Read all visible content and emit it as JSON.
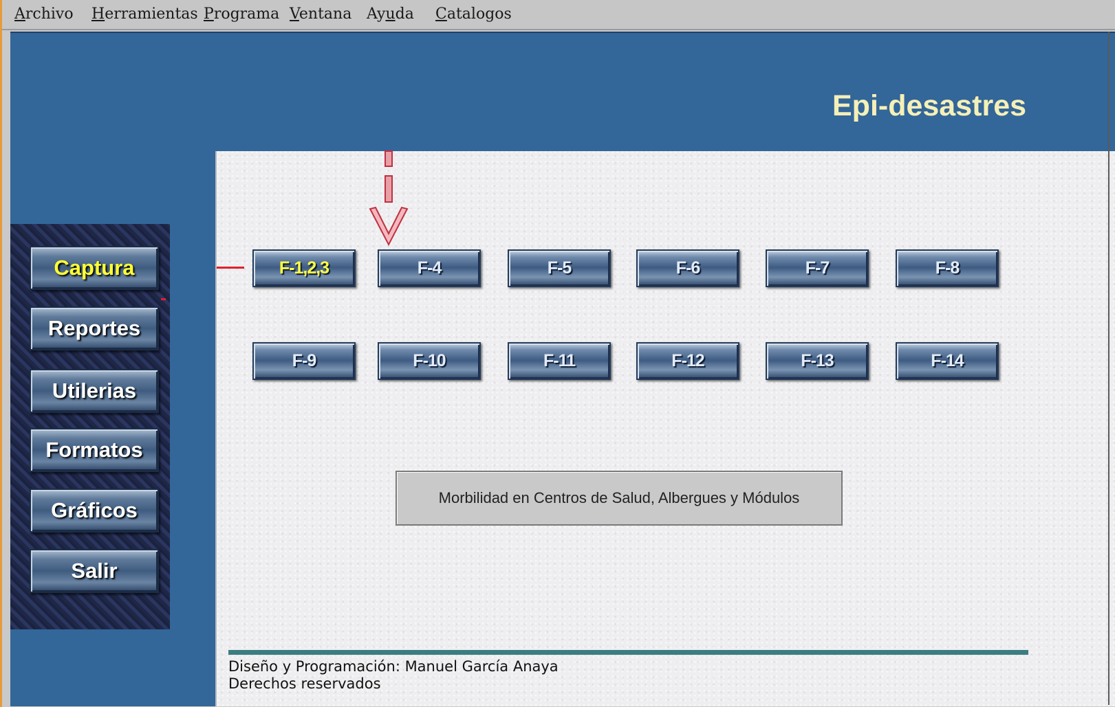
{
  "menubar": {
    "items": [
      {
        "accel": "A",
        "rest": "rchivo"
      },
      {
        "accel": "H",
        "rest": "erramientas"
      },
      {
        "accel": "P",
        "rest": "rograma"
      },
      {
        "accel": "V",
        "rest": "entana"
      },
      {
        "pre": "Ay",
        "accel": "u",
        "rest": "da"
      },
      {
        "accel": "C",
        "rest": "atalogos"
      }
    ]
  },
  "app": {
    "title": "Epi-desastres"
  },
  "sidebar": {
    "items": [
      {
        "label": "Captura",
        "active": true
      },
      {
        "label": "Reportes",
        "active": false
      },
      {
        "label": "Utilerias",
        "active": false
      },
      {
        "label": "Formatos",
        "active": false
      },
      {
        "label": "Gráficos",
        "active": false
      },
      {
        "label": "Salir",
        "active": false
      }
    ]
  },
  "forms": {
    "row1": [
      {
        "label": "F-1,2,3",
        "active": true
      },
      {
        "label": "F-4",
        "active": false
      },
      {
        "label": "F-5",
        "active": false
      },
      {
        "label": "F-6",
        "active": false
      },
      {
        "label": "F-7",
        "active": false
      },
      {
        "label": "F-8",
        "active": false
      }
    ],
    "row2": [
      {
        "label": "F-9",
        "active": false
      },
      {
        "label": "F-10",
        "active": false
      },
      {
        "label": "F-11",
        "active": false
      },
      {
        "label": "F-12",
        "active": false
      },
      {
        "label": "F-13",
        "active": false
      },
      {
        "label": "F-14",
        "active": false
      }
    ]
  },
  "info": {
    "text": "Morbilidad en Centros de Salud, Albergues y Módulos"
  },
  "footer": {
    "credit": "Diseño y Programación: Manuel García Anaya",
    "rights": "Derechos reservados"
  },
  "colors": {
    "background_blue": "#336699",
    "title_color": "#f5f0b8",
    "active_label": "#ffff33",
    "connector_red": "#e0202a",
    "footer_line": "#3b7d80"
  }
}
